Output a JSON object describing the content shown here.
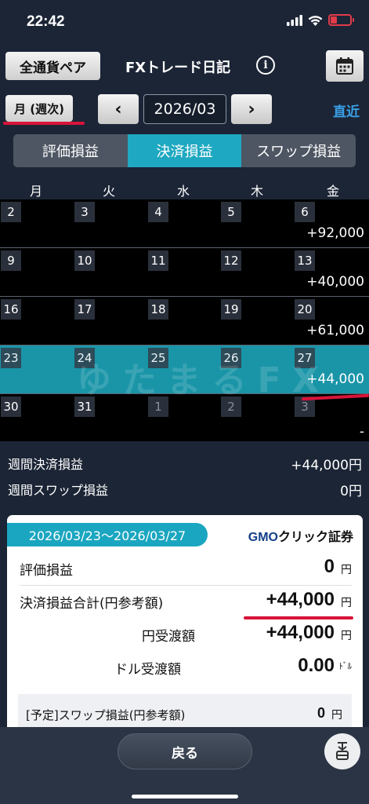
{
  "status": {
    "time": "22:42"
  },
  "nav": {
    "pair_button": "全通貨ペア",
    "title": "FXトレード日記",
    "info_icon": "i"
  },
  "period": {
    "week_button": "月 (週次)",
    "prev": "‹",
    "month": "2026/03",
    "next": "›",
    "latest": "直近"
  },
  "tabs": [
    {
      "label": "評価損益"
    },
    {
      "label": "決済損益"
    },
    {
      "label": "スワップ損益"
    }
  ],
  "weekdays": [
    "月",
    "火",
    "水",
    "木",
    "金"
  ],
  "weeks": [
    {
      "days": [
        "2",
        "3",
        "4",
        "5",
        "6"
      ],
      "value": "+92,000"
    },
    {
      "days": [
        "9",
        "10",
        "11",
        "12",
        "13"
      ],
      "value": "+40,000"
    },
    {
      "days": [
        "16",
        "17",
        "18",
        "19",
        "20"
      ],
      "value": "+61,000"
    },
    {
      "days": [
        "23",
        "24",
        "25",
        "26",
        "27"
      ],
      "value": "+44,000"
    },
    {
      "days": [
        "30",
        "31",
        "1",
        "2",
        "3"
      ],
      "value": "-"
    }
  ],
  "watermark": "ゆたまるFX",
  "summary": {
    "realized_label": "週間決済損益",
    "realized_value": "+44,000円",
    "swap_label": "週間スワップ損益",
    "swap_value": "0円"
  },
  "card": {
    "date_range": "2026/03/23～2026/03/27",
    "logo_gmo": "GMO",
    "logo_rest": "クリック証券",
    "rows": [
      {
        "label": "評価損益",
        "value": "0",
        "unit": "円"
      },
      {
        "label": "決済損益合計(円参考額)",
        "value": "+44,000",
        "unit": "円"
      },
      {
        "label": "円受渡額",
        "value": "+44,000",
        "unit": "円"
      },
      {
        "label": "ドル受渡額",
        "value": "0.00",
        "unit": "ﾄﾞﾙ"
      }
    ],
    "swap": {
      "label": "[予定]スワップ損益(円参考額)",
      "value": "0",
      "unit": "円"
    }
  },
  "bottom": {
    "back_label": "戻る"
  },
  "colors": {
    "accent": "#1fa8c1",
    "link": "#3aa0e6",
    "annotation_red": "#d8143a",
    "battery": "#e23b4a"
  }
}
